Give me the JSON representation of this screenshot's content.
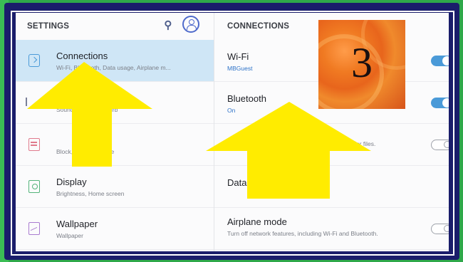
{
  "left_pane": {
    "title": "SETTINGS",
    "items": [
      {
        "title": "Connections",
        "subtitle": "Wi-Fi, Bluetooth, Data usage, Airplane m..."
      },
      {
        "title": "",
        "subtitle": "Sounds, Do not disturb"
      },
      {
        "title": "",
        "subtitle": "Block, allow, prioritize"
      },
      {
        "title": "Display",
        "subtitle": "Brightness, Home screen"
      },
      {
        "title": "Wallpaper",
        "subtitle": "Wallpaper"
      }
    ]
  },
  "right_pane": {
    "title": "CONNECTIONS",
    "wifi": {
      "title": "Wi-Fi",
      "status": "MBGuest",
      "enabled": true
    },
    "bluetooth": {
      "title": "Bluetooth",
      "status": "On",
      "enabled": true
    },
    "visibility": {
      "desc": "Allow other devices to find your tablet and transfer files.",
      "enabled": false
    },
    "data_usage": {
      "title": "Data usage"
    },
    "airplane": {
      "title": "Airplane mode",
      "desc": "Turn off network features, including Wi-Fi and Bluetooth.",
      "enabled": false
    }
  },
  "step_badge": {
    "number": "3"
  },
  "colors": {
    "accent": "#4a9ad8",
    "arrow": "#ffec00",
    "frame": "#1a1d6b",
    "background": "#2fa84a",
    "badge": "#e8651c"
  },
  "icons": [
    "search-icon",
    "account-icon",
    "connections-icon",
    "sound-icon",
    "block-icon",
    "display-icon",
    "wallpaper-icon"
  ]
}
